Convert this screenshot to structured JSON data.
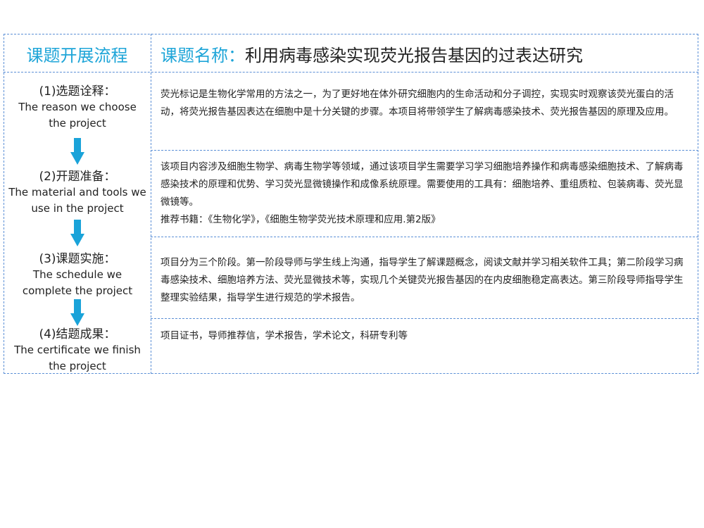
{
  "header": {
    "left_title": "课题开展流程",
    "right_label": "课题名称：",
    "right_value": "利用病毒感染实现荧光报告基因的过表达研究"
  },
  "steps": [
    {
      "cn": "(1)选题诠释：",
      "en1": "The reason we choose",
      "en2": "the project"
    },
    {
      "cn": "(2)开题准备：",
      "en1": "The material and tools we",
      "en2": "use in the project"
    },
    {
      "cn": "(3)课题实施：",
      "en1": "The schedule we",
      "en2": "complete the project"
    },
    {
      "cn": "(4)结题成果：",
      "en1": "The certificate we finish",
      "en2": "the project"
    }
  ],
  "content": {
    "reason": "荧光标记是生物化学常用的方法之一，为了更好地在体外研究细胞内的生命活动和分子调控，实现实时观察该荧光蛋白的活动，将荧光报告基因表达在细胞中是十分关键的步骤。本项目将带领学生了解病毒感染技术、荧光报告基因的原理及应用。",
    "material": "该项目内容涉及细胞生物学、病毒生物学等领域，通过该项目学生需要学习学习细胞培养操作和病毒感染细胞技术、了解病毒感染技术的原理和优势、学习荧光显微镜操作和成像系统原理。需要使用的工具有：细胞培养、重组质粒、包装病毒、荧光显微镜等。",
    "books": "推荐书籍：《生物化学》，《细胞生物学荧光技术原理和应用.第2版》",
    "schedule": "项目分为三个阶段。第一阶段导师与学生线上沟通，指导学生了解课题概念，阅读文献并学习相关软件工具；第二阶段学习病毒感染技术、细胞培养方法、荧光显微技术等，实现几个关键荧光报告基因的在内皮细胞稳定高表达。第三阶段导师指导学生整理实验结果，指导学生进行规范的学术报告。",
    "results": "项目证书，导师推荐信，学术报告，学术论文，科研专利等"
  },
  "colors": {
    "accent": "#1ea5d8",
    "border": "#5b8fd6",
    "arrow": "#1aa3d9"
  },
  "icons": {
    "flow_arrow": "down-arrow-icon"
  }
}
